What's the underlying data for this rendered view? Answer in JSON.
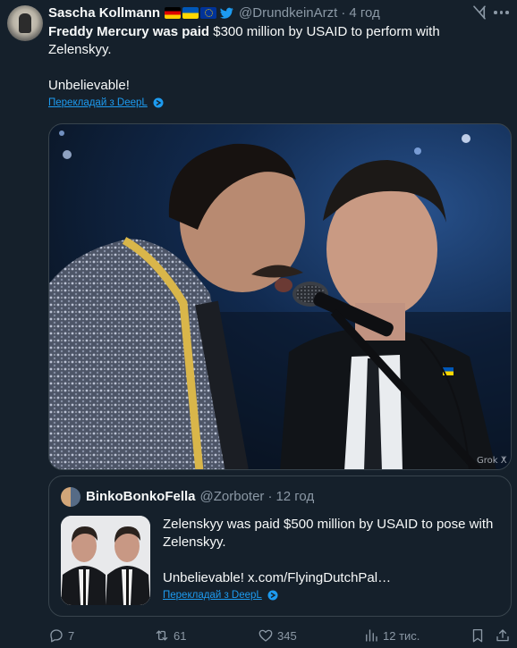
{
  "tweet": {
    "author_name": "Sascha Kollmann",
    "handle": "@DrundkeinArzt",
    "separator": "·",
    "time": "4 год",
    "text_bold": "Freddy Mercury was paid",
    "text_rest": " $300 million by USAID to perform with Zelenskyy.",
    "text_line2": "Unbelievable!",
    "translate_label": "Перекладай з DeepL",
    "flags": [
      "flag-germany",
      "flag-ukraine",
      "flag-eu"
    ],
    "icons": {
      "bird": "twitter-bird-icon",
      "grok": "grok-icon",
      "more": "more-icon",
      "deepl": "deepl-icon"
    }
  },
  "quoted": {
    "author_name": "BinkoBonkoFella",
    "handle": "@Zorboter",
    "separator": "·",
    "time": "12 год",
    "text_line1": "Zelenskyy was paid $500 million by USAID to pose with Zelenskyy.",
    "text_line2": "Unbelievable!  x.com/FlyingDutchPal…",
    "translate_label": "Перекладай з DeepL"
  },
  "actions": {
    "reply_count": "7",
    "retweet_count": "61",
    "like_count": "345",
    "views_count": "12 тис."
  },
  "colors": {
    "background": "#15202b",
    "text": "#f7f9f9",
    "muted": "#8b98a5",
    "link": "#1d9bf0",
    "border": "#38444d"
  }
}
